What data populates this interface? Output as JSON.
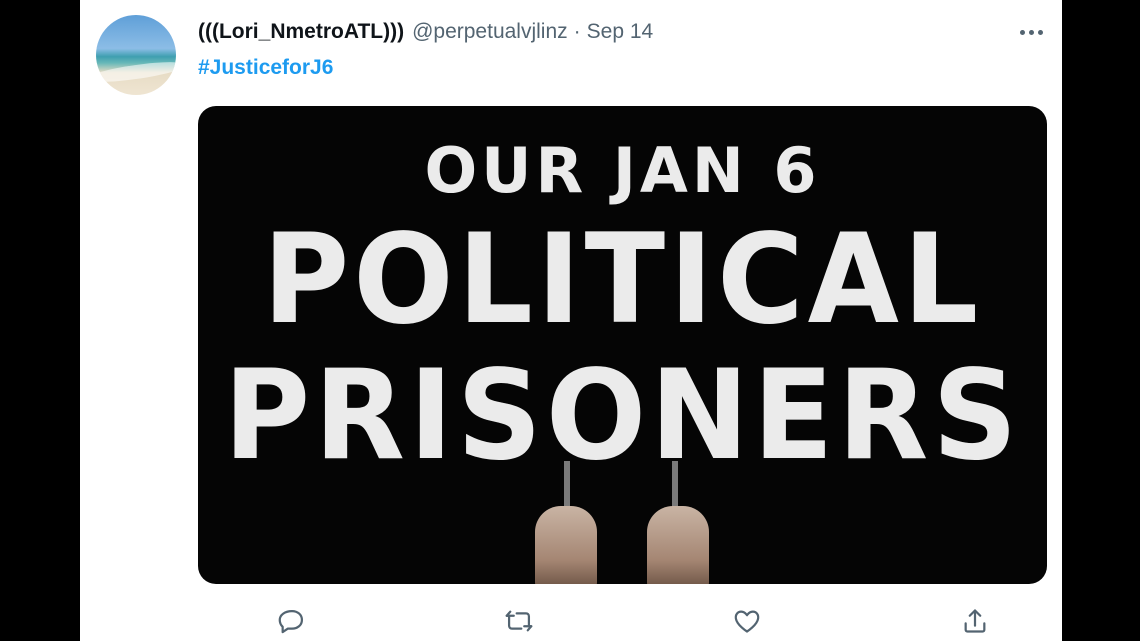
{
  "tweet": {
    "display_name": "(((Lori_NmetroATL)))",
    "handle": "@perpetualvjlinz",
    "separator": "·",
    "date": "Sep 14",
    "hashtag": "#JusticeforJ6",
    "image_text": {
      "line1": "OUR JAN 6",
      "line2": "POLITICAL",
      "line3": "PRISONERS"
    }
  },
  "icons": {
    "avatar": "beach-avatar",
    "more": "more-horizontal-icon",
    "reply": "reply-icon",
    "retweet": "retweet-icon",
    "like": "heart-icon",
    "share": "share-icon"
  },
  "colors": {
    "link": "#1d9bf0",
    "name": "#0f1419",
    "secondary": "#536471",
    "background": "#ffffff",
    "frame": "#000000"
  }
}
